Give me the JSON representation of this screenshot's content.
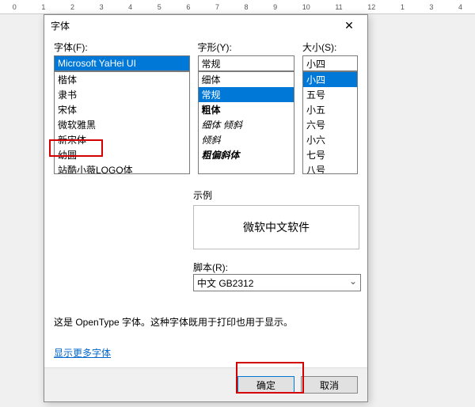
{
  "ruler": {
    "marks": [
      "0",
      "1",
      "2",
      "3",
      "4",
      "5",
      "6",
      "7",
      "8",
      "9",
      "10",
      "11",
      "12",
      "1",
      "3",
      "4"
    ]
  },
  "dialog": {
    "title": "字体"
  },
  "font": {
    "label": "字体(F):",
    "value": "Microsoft YaHei UI",
    "items": [
      "楷体",
      "隶书",
      "宋体",
      "微软雅黑",
      "新宋体",
      "幼圆",
      "站酷小薇LOGO体"
    ]
  },
  "style": {
    "label": "字形(Y):",
    "value": "常规",
    "items": [
      {
        "text": "细体",
        "cls": ""
      },
      {
        "text": "常规",
        "cls": "selected"
      },
      {
        "text": "粗体",
        "cls": "bold"
      },
      {
        "text": "细体 倾斜",
        "cls": "italic"
      },
      {
        "text": "倾斜",
        "cls": "italic"
      },
      {
        "text": "粗偏斜体",
        "cls": "boldi"
      }
    ]
  },
  "size": {
    "label": "大小(S):",
    "value": "小四",
    "items": [
      "小四",
      "五号",
      "小五",
      "六号",
      "小六",
      "七号",
      "八号"
    ]
  },
  "sample": {
    "label": "示例",
    "text": "微软中文软件"
  },
  "script": {
    "label": "脚本(R):",
    "value": "中文 GB2312"
  },
  "info": "这是 OpenType 字体。这种字体既用于打印也用于显示。",
  "link": "显示更多字体",
  "buttons": {
    "ok": "确定",
    "cancel": "取消"
  }
}
